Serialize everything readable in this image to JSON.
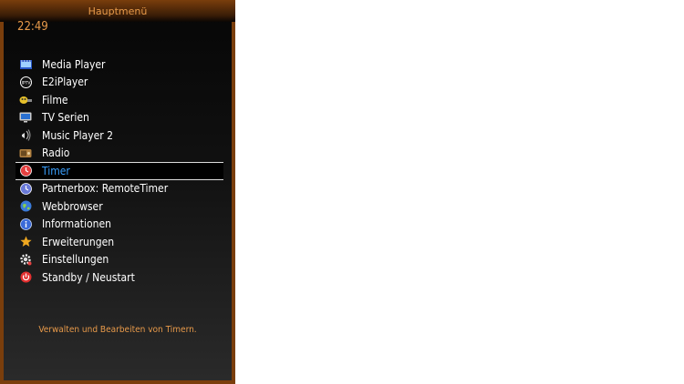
{
  "window": {
    "title": "Hauptmenü"
  },
  "clock": "22:49",
  "menu": {
    "selected_index": 6,
    "items": [
      {
        "label": "Media Player",
        "icon": "film-icon"
      },
      {
        "label": "E2iPlayer",
        "icon": "iptv-icon"
      },
      {
        "label": "Filme",
        "icon": "movies-icon"
      },
      {
        "label": "TV Serien",
        "icon": "tv-icon"
      },
      {
        "label": "Music Player 2",
        "icon": "music-icon"
      },
      {
        "label": "Radio",
        "icon": "radio-icon"
      },
      {
        "label": "Timer",
        "icon": "timer-icon"
      },
      {
        "label": "Partnerbox: RemoteTimer",
        "icon": "clock-icon"
      },
      {
        "label": "Webbrowser",
        "icon": "globe-icon"
      },
      {
        "label": "Informationen",
        "icon": "info-icon"
      },
      {
        "label": "Erweiterungen",
        "icon": "star-icon"
      },
      {
        "label": "Einstellungen",
        "icon": "gear-icon"
      },
      {
        "label": "Standby / Neustart",
        "icon": "power-icon"
      }
    ]
  },
  "description": "Verwalten und Bearbeiten von Timern.",
  "colors": {
    "frame": "#7a3e0c",
    "accent_text": "#e89a4a",
    "selected_text": "#3aa0ff"
  }
}
